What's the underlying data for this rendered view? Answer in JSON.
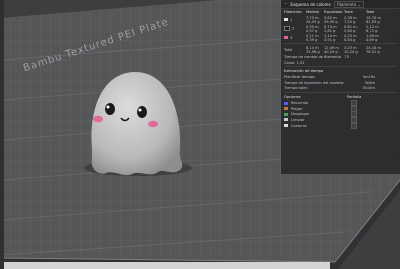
{
  "bed": {
    "label": "Bambu Textured PEI Plate"
  },
  "panel": {
    "title": "Esquema de colores",
    "dropdown": "Filamento",
    "columns": [
      "Filamento",
      "Modelo",
      "Expulsado",
      "Torre",
      "Total"
    ],
    "rows": [
      {
        "id": "1",
        "color": "#e8e8e8",
        "modelo": "7,73 m\n24,55 g",
        "expulsado": "9,62 m\n29,99 g",
        "torre": "2,36 m\n7,50 g",
        "total": "19,70 m\n61,93 g"
      },
      {
        "id": "2",
        "color": "#1c1c1c",
        "modelo": "0,30 m\n0,97 g",
        "expulsado": "0,74 m\n2,81 g",
        "torre": "0,81 m\n2,60 g",
        "total": "2,12 m\n6,72 g"
      },
      {
        "id": "3",
        "color": "#e06a9a",
        "modelo": "0,11 m\n0,39 g",
        "expulsado": "1,14 m\n3,51 g",
        "torre": "0,25 m\n0,83 g",
        "total": "1,46 m\n4,69 g"
      }
    ],
    "total": {
      "label": "Total",
      "modelo": "8,14 m\n25,98 g",
      "expulsado": "12,49 m\n40,29 g",
      "torre": "3,23 m\n10,24 g",
      "total": "24,18 m\n76,51 g"
    },
    "change_time_label": "Tiempo de cambio de filamento",
    "change_time_value": "75",
    "cost_label": "Coste",
    "cost_value": "1,91",
    "estimate_title": "Estimación de tiempo",
    "estimates": [
      {
        "label": "Planificar tiempo:",
        "value": "5m19s"
      },
      {
        "label": "Tiempo de impresión del modelo:",
        "value": "3h8m"
      },
      {
        "label": "Tiempo total:",
        "value": "3h14m"
      }
    ],
    "options_title": "Opciones",
    "screen_title": "Pantalla",
    "options": [
      {
        "label": "Recorrido",
        "color": "#5a5cff",
        "checked": false
      },
      {
        "label": "Plegar",
        "color": "#c08040",
        "checked": false
      },
      {
        "label": "Desplegar",
        "color": "#4aa060",
        "checked": false
      },
      {
        "label": "Limpiar",
        "color": "#cfcfcf",
        "checked": false
      },
      {
        "label": "Costuras",
        "color": "#e0e0e0",
        "checked": false
      }
    ]
  },
  "model": {
    "name": "ghost"
  }
}
